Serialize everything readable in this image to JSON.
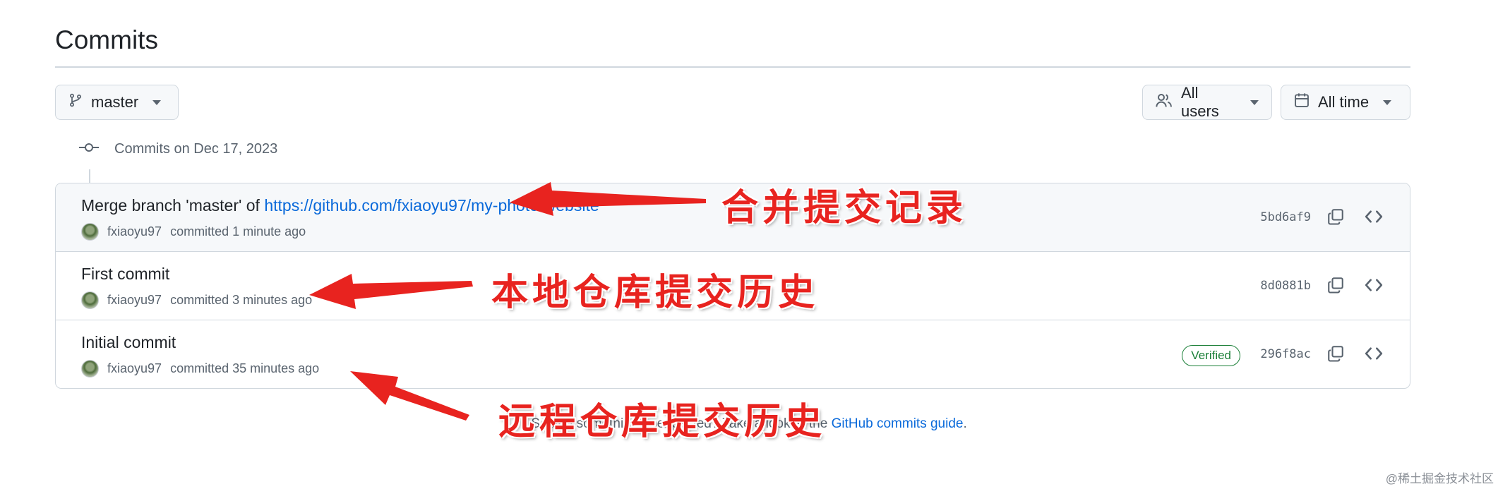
{
  "page": {
    "title": "Commits"
  },
  "filters": {
    "branch": "master",
    "users": "All users",
    "time": "All time"
  },
  "group": {
    "label": "Commits on Dec 17, 2023"
  },
  "commits": [
    {
      "message_prefix": "Merge branch 'master' of ",
      "message_link": "https://github.com/fxiaoyu97/my-photo-website",
      "author": "fxiaoyu97",
      "time": "committed 1 minute ago",
      "sha": "5bd6af9",
      "verified": ""
    },
    {
      "message_prefix": "First commit",
      "message_link": "",
      "author": "fxiaoyu97",
      "time": "committed 3 minutes ago",
      "sha": "8d0881b",
      "verified": ""
    },
    {
      "message_prefix": "Initial commit",
      "message_link": "",
      "author": "fxiaoyu97",
      "time": "committed 35 minutes ago",
      "sha": "296f8ac",
      "verified": "Verified"
    }
  ],
  "footer": {
    "text": "Seeing something unexpected? Take a look at the ",
    "link": "GitHub commits guide",
    "end": "."
  },
  "annotations": [
    "合并提交记录",
    "本地仓库提交历史",
    "远程仓库提交历史"
  ],
  "watermark": "@稀土掘金技术社区",
  "colors": {
    "accent": "#0969da",
    "annotation": "#e8231f",
    "verified": "#1a7f37",
    "border": "#d0d7de"
  }
}
